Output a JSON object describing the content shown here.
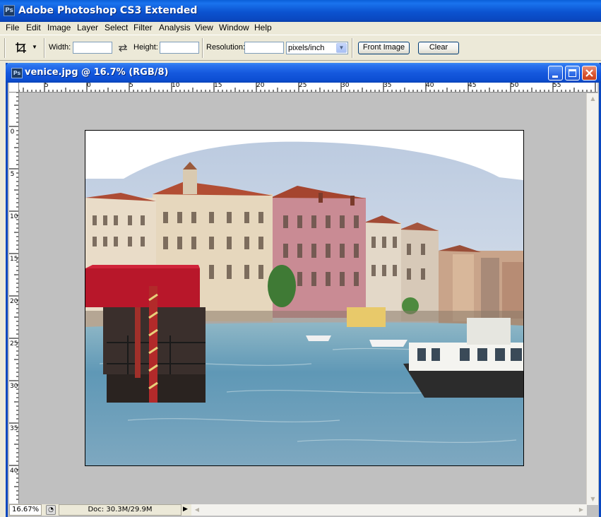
{
  "app": {
    "title": "Adobe Photoshop CS3 Extended",
    "logo_text": "Ps"
  },
  "menu": {
    "items": [
      {
        "label": "File"
      },
      {
        "label": "Edit"
      },
      {
        "label": "Image"
      },
      {
        "label": "Layer"
      },
      {
        "label": "Select"
      },
      {
        "label": "Filter"
      },
      {
        "label": "Analysis"
      },
      {
        "label": "View"
      },
      {
        "label": "Window"
      },
      {
        "label": "Help"
      }
    ]
  },
  "options": {
    "tool_icon": "crop-icon",
    "width_label": "Width:",
    "width_value": "",
    "swap_icon": "swap-arrows-icon",
    "height_label": "Height:",
    "height_value": "",
    "resolution_label": "Resolution:",
    "resolution_value": "",
    "unit_select": "pixels/inch",
    "front_image_label": "Front Image",
    "clear_label": "Clear"
  },
  "document": {
    "title": "venice.jpg @ 16.7% (RGB/8)",
    "logo_text": "Ps",
    "minimize_icon": "minimize-icon",
    "maximize_icon": "maximize-icon",
    "close_icon": "close-icon"
  },
  "rulers": {
    "horizontal": [
      "5",
      "0",
      "5",
      "10",
      "15",
      "20",
      "25",
      "30",
      "35",
      "40",
      "45",
      "50",
      "55"
    ],
    "vertical": [
      "0",
      "5",
      "10",
      "15",
      "20",
      "25",
      "30",
      "35",
      "40"
    ]
  },
  "status": {
    "zoom": "16.67%",
    "doc_info": "Doc: 30.3M/29.9M"
  },
  "colors": {
    "xp_blue": "#0a48c0",
    "canvas_gray": "#c0c0c0",
    "sky": "#c8d4e6",
    "water": "#5f98b6",
    "canopy_red": "#b8172a"
  }
}
